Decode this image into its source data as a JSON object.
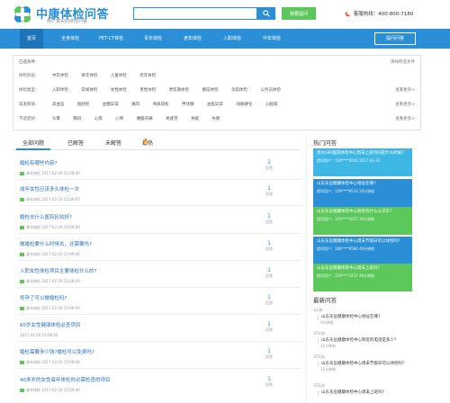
{
  "header": {
    "logo_title": "中康体检问答",
    "logo_subtitle": "用户真实的体检问答",
    "search_placeholder": "",
    "ask_button": "我要提问",
    "hotline": "客服热线：400-800-7180"
  },
  "nav": {
    "items": [
      "首页",
      "全身体检",
      "PET-CT体检",
      "青年体检",
      "老年体检",
      "入职体检",
      "中年体检"
    ],
    "login": "提问问答"
  },
  "filters": {
    "selected_label": "已选条件：",
    "clear_label": "清除所选条件",
    "rows": [
      {
        "label": "体检阶段：",
        "items": [
          "中年体检",
          "青年体检",
          "儿童体检",
          "老年体检"
        ],
        "more": ""
      },
      {
        "label": "体检类型：",
        "items": [
          "入职体检",
          "常规体检",
          "女性体检",
          "男性体检",
          "更年期体检",
          "婚前体检",
          "孕前体检",
          "公务员体检"
        ],
        "more": "查看更多>"
      },
      {
        "label": "高发疾病：",
        "items": [
          "高血压",
          "脂肪肝",
          "血糖异常",
          "痛风",
          "骨质疏松",
          "甲状腺",
          "血脂异常",
          "动脉硬化",
          "心脏病"
        ],
        "more": "查看更多>"
      },
      {
        "label": "不适症状：",
        "items": [
          "头晕",
          "胸闷",
          "心慌",
          "心悸",
          "腰酸背痛",
          "易疲劳",
          "失眠",
          "失眠"
        ],
        "more": "查看更多>"
      }
    ]
  },
  "tabs": [
    "全部问题",
    "已解答",
    "未解答",
    "最热"
  ],
  "questions": [
    {
      "title": "婚检有哪些内容?",
      "meta": "青年体检    2017-02-20 15:09:00",
      "count": "1",
      "label": "回答"
    },
    {
      "title": "成年女性应该多久体检一次",
      "meta": "青年体检    2017-02-20 15:09:00",
      "count": "1",
      "label": "回答"
    },
    {
      "title": "婚检去什么医院比较好?",
      "meta": "青年体检    2017-02-20 15:09:00",
      "count": "1",
      "label": "回答"
    },
    {
      "title": "做婚检要什么时候去，还需要吗?",
      "meta": "青年体检    2017-02-20 15:09:00",
      "count": "1",
      "label": "回答"
    },
    {
      "title": "入职女性体检项目主要体检什么的?",
      "meta": "青年体检    2017-02-20 15:09:00",
      "count": "1",
      "label": "回答"
    },
    {
      "title": "怀孕了可以做婚检吗?",
      "meta": "青年体检    2017-02-20 15:09:00",
      "count": "1",
      "label": "回答"
    },
    {
      "title": "60岁女性健康体检必查项目",
      "meta": "2017-02-20 15:09:00",
      "count": "1",
      "label": "回答"
    },
    {
      "title": "婚检需要多少钱?婚检可以免费吗?",
      "meta": "青年体检    2017-02-20 15:09:00",
      "count": "1",
      "label": "回答"
    },
    {
      "title": "40多岁的女性每年体检时必需检查的项目",
      "meta": "青年体检    2017-02-20 15:09:00",
      "count": "1",
      "label": "回答"
    }
  ],
  "hot": {
    "title": "热门问答",
    "items": [
      {
        "title": "贵州180医院体检中心周末上班时间是什么时候?",
        "meta": "提问用户：159****9500    2017-03-23",
        "color": "#3fb7e5"
      },
      {
        "title": "山东东岳健康体检中心地址在哪?",
        "meta": "提问用户：159****9514    20分钟前",
        "color": "#2a8fd6"
      },
      {
        "title": "山东东岳健康体检中心附近有什么公交车?",
        "meta": "提问用户：155****1627    30分钟前",
        "color": "#5cc85c"
      },
      {
        "title": "山东东岳健康体检中心周末节假日可以体检吗?",
        "meta": "提问用户：186****9584    40分钟前",
        "color": "#2a8fd6"
      },
      {
        "title": "山东东岳健康体检中心周末上班吗?",
        "meta": "提问用户：159****5437    40分钟前",
        "color": "#5cc85c"
      }
    ]
  },
  "latest": {
    "title": "最新问答",
    "items": [
      {
        "date": "3天前",
        "title": "山东东岳健康体检中心地址在哪?",
        "sub": "9分钟前"
      },
      {
        "date": "15天前",
        "title": "山东东岳健康体检中心附近的电话是多少?",
        "sub": "11分钟前"
      },
      {
        "date": "35天前",
        "title": "山东东岳健康体检中心周末节假日可以体检吗?",
        "sub": "11分钟前"
      },
      {
        "date": "35天前",
        "title": "山东东岳健康体检中心周末上班吗?",
        "sub": "11分钟前"
      }
    ]
  },
  "colors": {
    "accent": "#2a8fd6",
    "green": "#5cc85c",
    "fire": "#e8533a"
  }
}
